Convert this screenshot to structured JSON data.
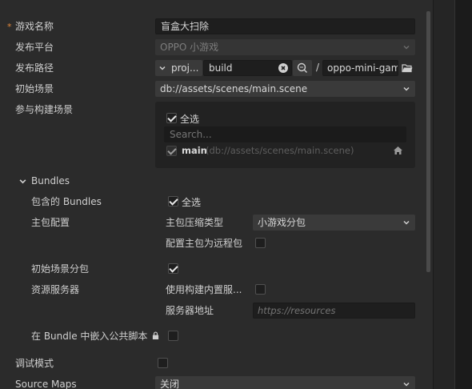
{
  "fields": {
    "game_name": {
      "label": "游戏名称",
      "required_mark": "*",
      "value": "盲盒大扫除"
    },
    "platform": {
      "label": "发布平台",
      "value": "OPPO 小游戏"
    },
    "build_path": {
      "label": "发布路径",
      "prefix": "proj...",
      "value": "build",
      "separator": "/",
      "suffix": "oppo-mini-game"
    },
    "start_scene": {
      "label": "初始场景",
      "value": "db://assets/scenes/main.scene"
    },
    "scenes": {
      "label": "参与构建场景",
      "select_all": "全选",
      "search_placeholder": "Search...",
      "items": [
        {
          "name": "main",
          "path": "(db://assets/scenes/main.scene)"
        }
      ]
    }
  },
  "bundles": {
    "title": "Bundles",
    "included_label": "包含的 Bundles",
    "included_select_all": "全选",
    "main_pkg_label": "主包配置",
    "compress_label": "主包压缩类型",
    "compress_value": "小游戏分包",
    "remote_label": "配置主包为远程包",
    "start_scene_sub_label": "初始场景分包",
    "res_server_label": "资源服务器",
    "builtin_server_label": "使用构建内置服...",
    "server_addr_label": "服务器地址",
    "server_addr_placeholder": "https://resources",
    "embed_label": "在 Bundle 中嵌入公共脚本"
  },
  "debug": {
    "label": "调试模式"
  },
  "source_maps": {
    "label": "Source Maps",
    "value": "关闭"
  }
}
